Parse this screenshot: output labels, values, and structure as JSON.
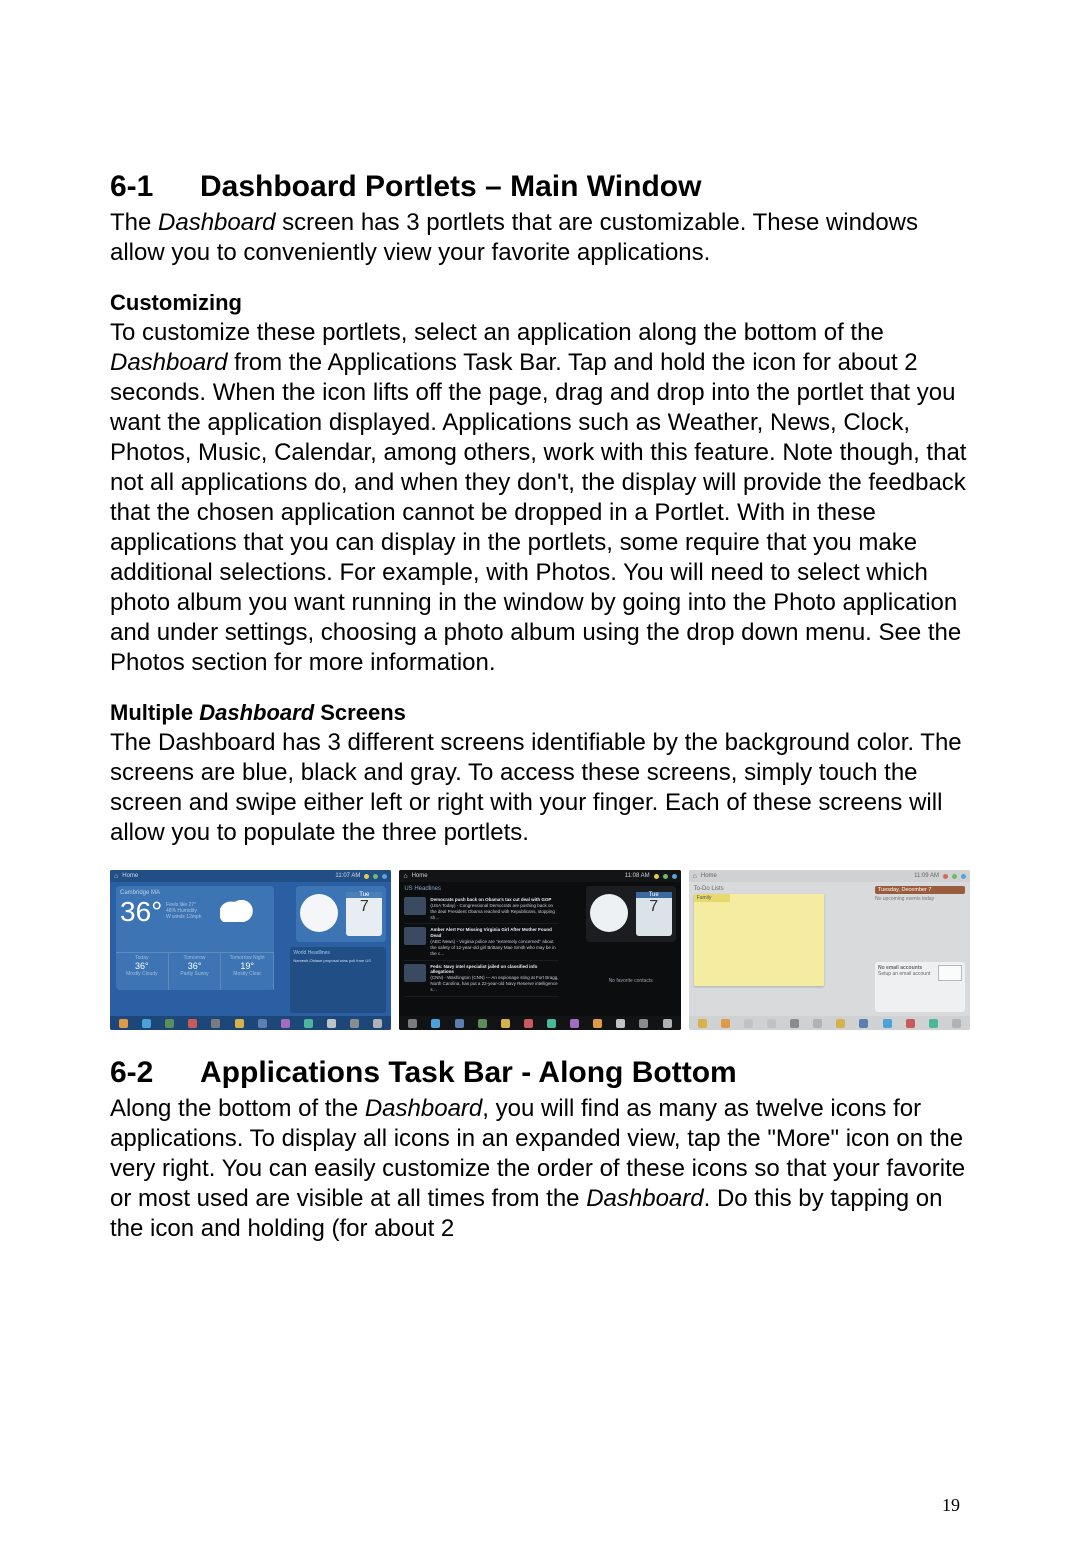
{
  "page_number": "19",
  "section_6_1": {
    "number": "6-1",
    "title": "Dashboard Portlets – Main Window",
    "intro_pre": "The ",
    "intro_em": "Dashboard",
    "intro_post": " screen has 3 portlets that are customizable.    These windows allow you to conveniently view your favorite applications.",
    "customizing_heading": "Customizing",
    "customizing_pre": "To customize these portlets, select an application along the bottom of the ",
    "customizing_em": "Dashboard",
    "customizing_post": " from the Applications Task Bar.    Tap and hold the icon for about 2 seconds.    When the icon lifts off the page, drag and drop into the portlet that you want the application displayed.    Applications such as Weather, News, Clock, Photos, Music, Calendar, among others, work with this feature.    Note though, that not all applications do, and when they don't, the display will provide the feedback that the chosen application cannot be dropped in a Portlet.    With in these applications that you can display in the portlets, some require that you make additional selections. For example, with Photos.    You will need to select which photo album you want running in the window by going into the Photo application and under settings, choosing a photo album using the drop down menu.    See the Photos section for more information.",
    "multiple_heading_pre": "Multiple ",
    "multiple_heading_em": "Dashboard",
    "multiple_heading_post": " Screens",
    "multiple_body": "The Dashboard has 3 different screens identifiable by the background color.    The screens are blue, black and gray.    To access these screens, simply touch the screen and swipe either left or right with your finger.   Each of these screens will allow you to populate the three portlets."
  },
  "section_6_2": {
    "number": "6-2",
    "title": "Applications Task Bar -    Along Bottom",
    "body_1": "Along the bottom of the ",
    "body_em1": "Dashboard",
    "body_2": ", you will find as many as twelve icons for applications.    To display all icons in an expanded view, tap the \"More\" icon on the very right.    You can easily customize the order of these icons so that your favorite or most used are visible at all times from the ",
    "body_em2": "Dashboard",
    "body_3": ".    Do this by tapping on the icon and holding (for about 2"
  },
  "screenshots": {
    "home_label": "Home",
    "s1": {
      "time": "11:07 AM",
      "location": "Cambridge MA",
      "temp": "36°",
      "feels": "Feels like 27°",
      "humidity": "48% Humidity",
      "wind": "W winds 12mph",
      "cal_day": "Tue",
      "cal_num": "7",
      "fc_a_label": "Today",
      "fc_a_temp": "36°",
      "fc_a_cond": "Mostly Cloudy",
      "fc_b_label": "Tomorrow",
      "fc_b_temp": "36°",
      "fc_b_cond": "Partly Sunny",
      "fc_c_label": "Tomorrow Night",
      "fc_c_temp": "19°",
      "fc_c_cond": "Mostly Clear",
      "news_h": "World Headlines",
      "news_l1": "Namesh-Obiase proposal wins poll from US"
    },
    "s2": {
      "time": "11:08 AM",
      "headlines": "US Headlines",
      "cal_day": "Tue",
      "cal_num": "7",
      "item1": "Democrats push back on Obama's tax cut deal with GOP",
      "item1_sub": "(USA Today) - Congressional Democrats are pushing back on the deal President Obama reached with Republicans, stopping sh…",
      "item2": "Amber Alert For Missing Virginia Girl After Mother Found Dead",
      "item2_sub": "(ABC News) - Virginia police are \"extremely concerned\" about the safety of 12-year-old girl Brittany Mae Smith who may be in the c…",
      "item3": "Feds: Navy intel specialist jailed on classified info allegations",
      "item3_sub": "(CNN) - Washington (CNN) — An espionage sting at Fort Bragg, North Carolina, has put a 22-year-old Navy Reserve intelligence s…",
      "no_fav": "No favorite contacts"
    },
    "s3": {
      "time": "11:09 AM",
      "todo": "To-Do Lists",
      "note_tab": "Family",
      "datebar": "Tuesday, December 7",
      "noevt": "No upcoming events today",
      "mail_h": "No email accounts",
      "mail_sub": "Setup an email account"
    }
  }
}
